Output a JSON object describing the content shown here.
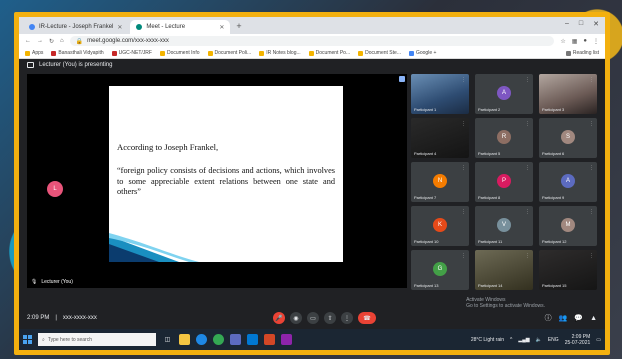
{
  "browser": {
    "tabs": [
      {
        "label": "IR-Lecture - Joseph Frankel",
        "active": false
      },
      {
        "label": "Meet - Lecture",
        "active": true
      }
    ],
    "address": "meet.google.com/xxx-xxxx-xxx",
    "bookmarks": [
      "Apps",
      "Banasthali Vidyapith",
      "UGC-NET/JRF",
      "Document Info",
      "Document Poli...",
      "IR Notes blog...",
      "Document Po...",
      "Document Ste...",
      "Google +",
      "Reading list"
    ]
  },
  "meet": {
    "presenting_banner": "Lecturer (You) is presenting",
    "stage": {
      "presenter_label": "Lecturer (You)",
      "presenter_initial": "L",
      "slide": {
        "title": "According to Joseph Frankel,",
        "body": "“foreign policy consists of decisions and actions, which involves to some appreciable extent relations between one state and others”"
      }
    },
    "participants": [
      {
        "name": "Participant 1",
        "initial": "",
        "color": "",
        "video": "video-a"
      },
      {
        "name": "Participant 2",
        "initial": "A",
        "color": "#7e57c2",
        "video": ""
      },
      {
        "name": "Participant 3",
        "initial": "",
        "color": "",
        "video": "video-b"
      },
      {
        "name": "Participant 4",
        "initial": "",
        "color": "",
        "video": "video-c"
      },
      {
        "name": "Participant 5",
        "initial": "R",
        "color": "#8d6e63",
        "video": ""
      },
      {
        "name": "Participant 6",
        "initial": "S",
        "color": "#a1887f",
        "video": ""
      },
      {
        "name": "Participant 7",
        "initial": "N",
        "color": "#f57c00",
        "video": ""
      },
      {
        "name": "Participant 8",
        "initial": "P",
        "color": "#d81b60",
        "video": ""
      },
      {
        "name": "Participant 9",
        "initial": "A",
        "color": "#5c6bc0",
        "video": ""
      },
      {
        "name": "Participant 10",
        "initial": "K",
        "color": "#e64a19",
        "video": ""
      },
      {
        "name": "Participant 11",
        "initial": "V",
        "color": "#78909c",
        "video": ""
      },
      {
        "name": "Participant 12",
        "initial": "M",
        "color": "#a1887f",
        "video": ""
      },
      {
        "name": "Participant 13",
        "initial": "G",
        "color": "#43a047",
        "video": ""
      },
      {
        "name": "Participant 14",
        "initial": "",
        "color": "",
        "video": "video-d"
      },
      {
        "name": "Participant 15",
        "initial": "",
        "color": "",
        "video": "video-e"
      }
    ],
    "bottom": {
      "time": "2:09 PM",
      "meeting_code": "xxx-xxxx-xxx",
      "activate_line1": "Activate Windows",
      "activate_line2": "Go to Settings to activate Windows."
    }
  },
  "taskbar": {
    "search_placeholder": "Type here to search",
    "weather": "28°C Light rain",
    "lang": "ENG",
    "time": "2:09 PM",
    "date": "25-07-2021"
  },
  "colors": {
    "frame": "#f3b00f",
    "meet_bg": "#202124",
    "end_call": "#ea4335"
  }
}
